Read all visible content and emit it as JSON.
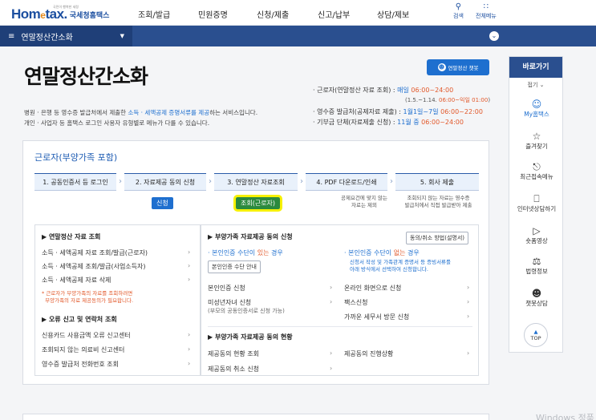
{
  "header": {
    "logo_small": "국민이 행복한 세정",
    "logo_main_a": "Hom",
    "logo_main_e": "e",
    "logo_main_b": "tax.",
    "logo_kr": "국세청홈택스",
    "nav": [
      "조회/발급",
      "민원증명",
      "신청/제출",
      "신고/납부",
      "상담/제보"
    ],
    "search_label": "검색",
    "menu_label": "전체메뉴"
  },
  "subbar": {
    "menu_label": "연말정산간소화"
  },
  "page": {
    "title": "연말정산간소화",
    "chatbot_label": "연말정산 챗봇",
    "desc1_pre": "병원 · 은행 등 영수증 발급처에서 제출한 ",
    "desc1_hl": "소득 · 세액공제 증명서류를 제공",
    "desc1_post": "하는 서비스입니다.",
    "desc2": "개인 · 사업자 등 홈택스 로그인 사용자 유형별로 메뉴가 다를 수 있습니다.",
    "info1_pre": "· 근로자(연말정산 자료 조회) : ",
    "info1_bl": "매일 ",
    "info1_or": "06:00~24:00",
    "info1_sub_a": "(1.5.~1.14. ",
    "info1_sub_or": "06:00~익일 01:00",
    "info1_sub_b": ")",
    "info2_pre": "· 영수증 발급처(공제자료 제출) : ",
    "info2_bl": "1월1일~7일 ",
    "info2_or": "06:00~22:00",
    "info3_pre": "· 기부금 단체(자료제출 신청) : ",
    "info3_bl": "11월 중 ",
    "info3_or": "06:00~24:00"
  },
  "card": {
    "title": "근로자(부양가족 포함)",
    "steps": [
      "1. 공동인증서 등 로그인",
      "2. 자료제공 동의 신청",
      "3. 연말정산 자료조회",
      "4. PDF 다운로드/인쇄",
      "5. 회사 제출"
    ],
    "badge_apply": "신청",
    "badge_lookup": "조회(근로자)",
    "note4a": "공제요건에 맞지 않는",
    "note4b": "자료는 제외",
    "note5a": "조회되지 않는 자료는 영수증",
    "note5b": "발급처에서 직접 발급받아 제출",
    "left_box": {
      "title1": "연말정산 자료 조회",
      "items1": [
        "소득 · 세액공제 자료 조회/발급(근로자)",
        "소득 · 세액공제 조회/발급(사업소득자)",
        "소득 · 세액공제 자료 삭제"
      ],
      "note_a": "* 근로자가 부양가족의 자료를 조회하려면",
      "note_b": "부양가족의 자료 제공동의가 필요합니다.",
      "title2": "오류 신고 및 연락처 조회",
      "items2": [
        "신용카드 사용금액 오류 신고센터",
        "조회되지 않는 의료비 신고센터",
        "영수증 발급처 전화번호 조회"
      ]
    },
    "right_box": {
      "title1": "부양가족 자료제공 동의 신청",
      "btn_method": "동의/취소 방법(설명서)",
      "cert_yes_a": "본인인증 수단이 ",
      "cert_yes_red": "있는",
      "cert_yes_b": " 경우",
      "btn_cert": "본인인증 수단 안내",
      "cert_no_a": "본인인증 수단이 ",
      "cert_no_red": "없는",
      "cert_no_b": " 경우",
      "cert_no_note_a": "신청서 작성 및 가족관계 증명서 등 증빙서류를",
      "cert_no_note_b": "아래 방식에서 선택하여 신청합니다.",
      "left_items": [
        "본인인증 신청",
        "미성년자녀 신청"
      ],
      "minor_sub": "(부모의 공동인증서로 신청 가능)",
      "right_items": [
        "온라인 화면으로 신청",
        "팩스신청",
        "가까운 세무서 방문 신청"
      ],
      "title2": "부양가족 자료제공 동의 현황",
      "status_left": [
        "제공동의 현황 조회",
        "제공동의 취소 신청"
      ],
      "status_right": [
        "제공동의 진행상황"
      ]
    }
  },
  "quick": {
    "title": "바로가기",
    "fold": "접기",
    "items": [
      {
        "label": "My홈택스",
        "icon": "person-icon"
      },
      {
        "label": "즐겨찾기",
        "icon": "star-icon"
      },
      {
        "label": "최근접속메뉴",
        "icon": "recent-icon"
      },
      {
        "label": "인터넷상담하기",
        "icon": "monitor-icon"
      },
      {
        "label": "숏폼영상",
        "icon": "play-icon"
      },
      {
        "label": "법령정보",
        "icon": "gavel-icon"
      },
      {
        "label": "챗봇상담",
        "icon": "chatbot-icon"
      }
    ],
    "top_label": "TOP"
  },
  "watermark": "Windows 정품"
}
